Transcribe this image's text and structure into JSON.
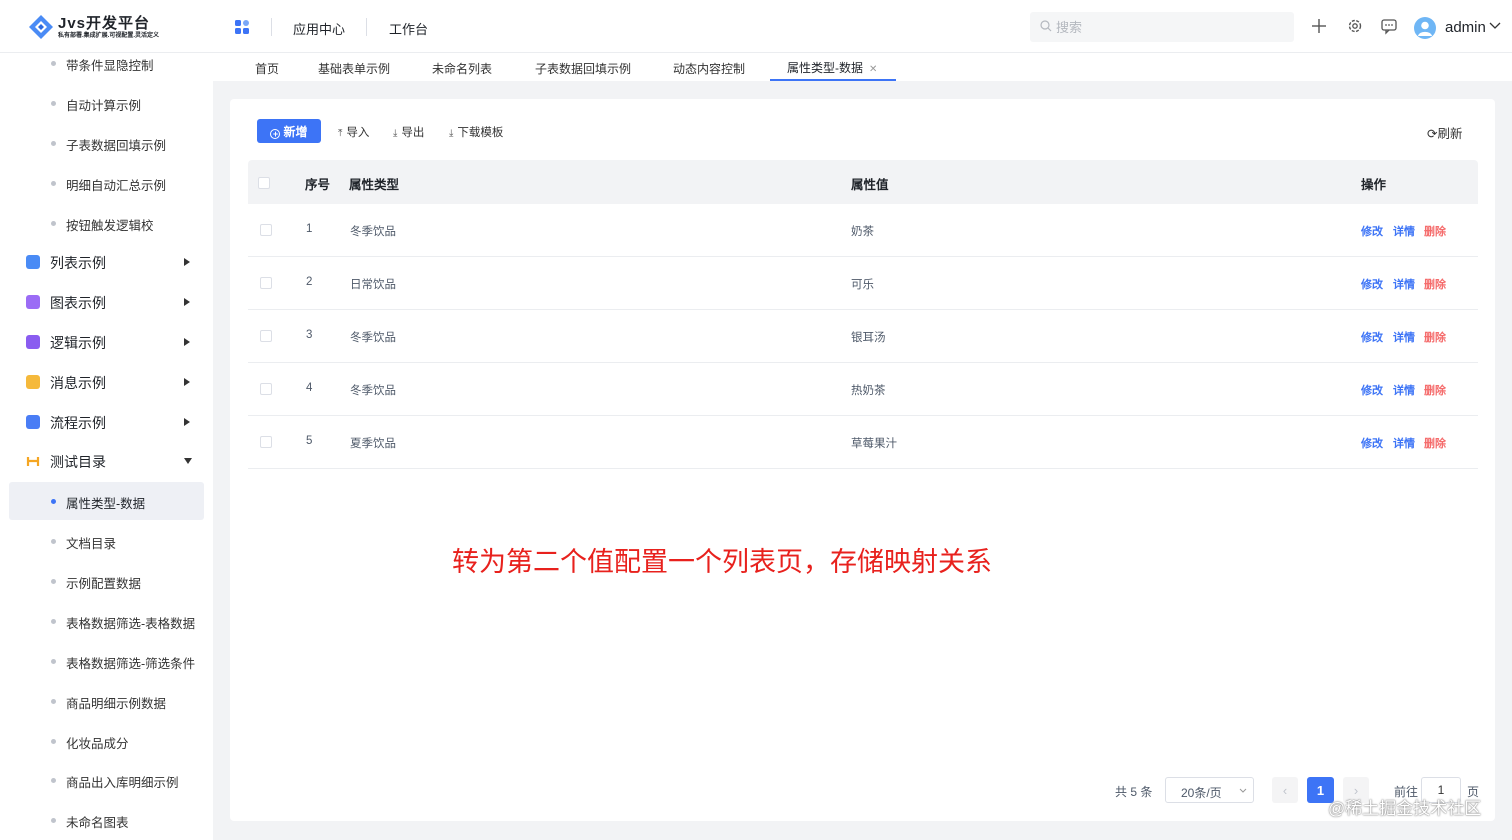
{
  "header": {
    "logo_title": "Jvs开发平台",
    "logo_subtitle": "私有部署.集成扩展.可视配置.灵活定义",
    "nav": [
      "应用中心",
      "工作台"
    ],
    "search_placeholder": "搜索",
    "user_name": "admin"
  },
  "sidebar": {
    "top_items": [
      "带条件显隐控制",
      "自动计算示例",
      "子表数据回填示例",
      "明细自动汇总示例",
      "按钮触发逻辑校"
    ],
    "groups": [
      {
        "label": "列表示例",
        "color": "#4a8bf5"
      },
      {
        "label": "图表示例",
        "color": "#9b6cf5"
      },
      {
        "label": "逻辑示例",
        "color": "#8a5cf0"
      },
      {
        "label": "消息示例",
        "color": "#f5b93b"
      },
      {
        "label": "流程示例",
        "color": "#4a7df5"
      },
      {
        "label": "测试目录",
        "color": "#f5a623"
      }
    ],
    "sub_items": [
      "属性类型-数据",
      "文档目录",
      "示例配置数据",
      "表格数据筛选-表格数据",
      "表格数据筛选-筛选条件",
      "商品明细示例数据",
      "化妆品成分",
      "商品出入库明细示例",
      "未命名图表"
    ]
  },
  "tabs": [
    "首页",
    "基础表单示例",
    "未命名列表",
    "子表数据回填示例",
    "动态内容控制",
    "属性类型-数据"
  ],
  "toolbar": {
    "new": "新增",
    "import": "导入",
    "export": "导出",
    "template": "下载模板",
    "refresh": "刷新"
  },
  "table": {
    "headers": {
      "index": "序号",
      "type": "属性类型",
      "value": "属性值",
      "ops": "操作"
    },
    "rows": [
      {
        "index": "1",
        "type": "冬季饮品",
        "value": "奶茶"
      },
      {
        "index": "2",
        "type": "日常饮品",
        "value": "可乐"
      },
      {
        "index": "3",
        "type": "冬季饮品",
        "value": "银耳汤"
      },
      {
        "index": "4",
        "type": "冬季饮品",
        "value": "热奶茶"
      },
      {
        "index": "5",
        "type": "夏季饮品",
        "value": "草莓果汁"
      }
    ],
    "op_labels": {
      "edit": "修改",
      "detail": "详情",
      "delete": "删除"
    }
  },
  "annotation": "转为第二个值配置一个列表页，存储映射关系",
  "pagination": {
    "total": "共 5 条",
    "page_size": "20条/页",
    "current": "1",
    "goto_label": "前往",
    "goto_value": "1",
    "page_suffix": "页"
  },
  "watermark": "@稀土掘金技术社区",
  "colors": {
    "primary": "#3d74f6",
    "danger": "#f56c6c",
    "annotation": "#e8211d"
  }
}
